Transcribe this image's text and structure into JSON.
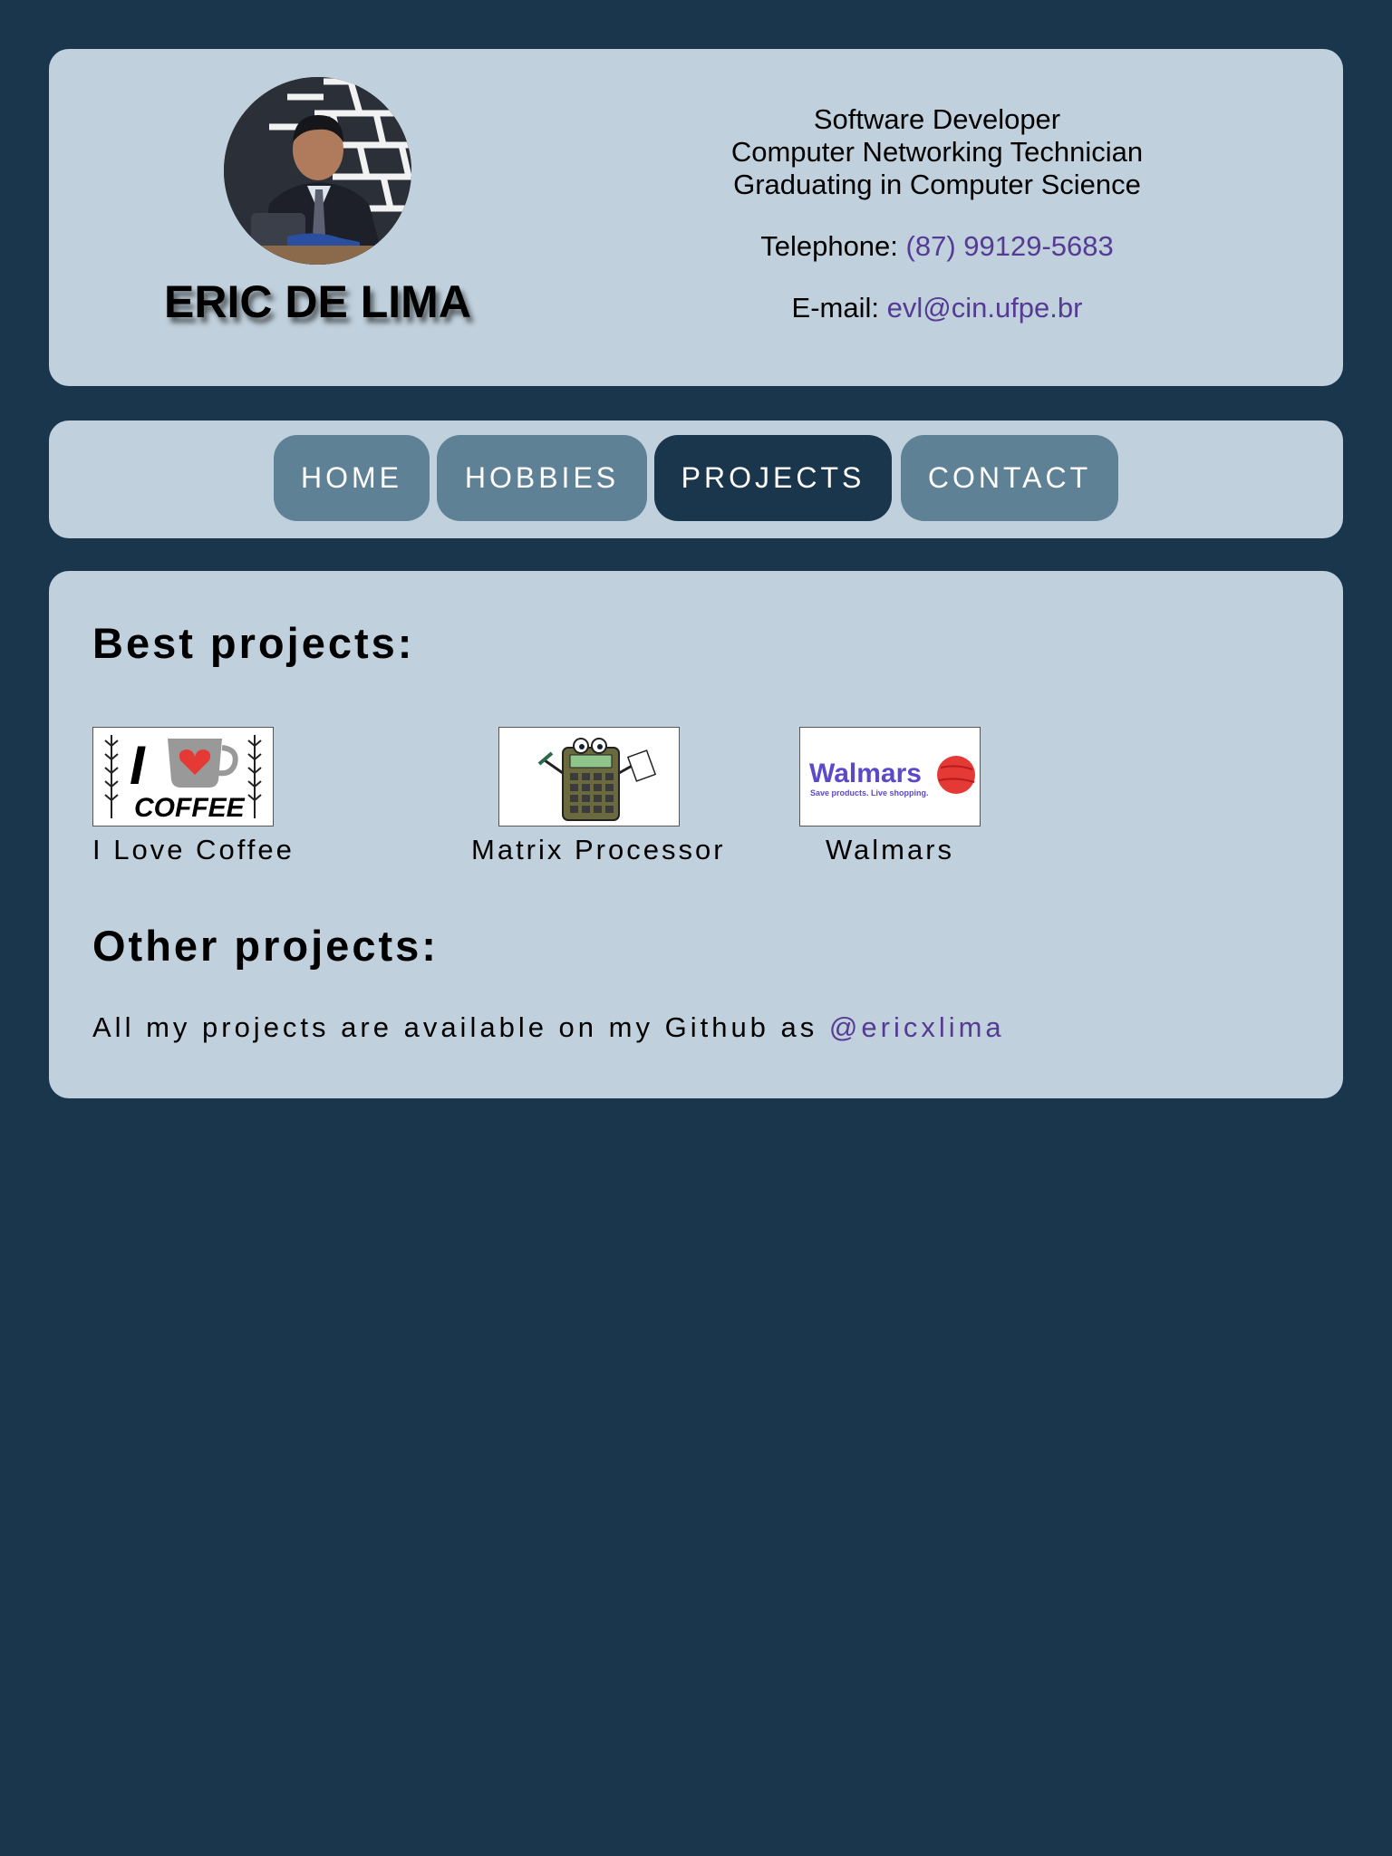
{
  "profile": {
    "name": "ERIC DE LIMA",
    "roles": [
      "Software Developer",
      "Computer Networking Technician",
      "Graduating in Computer Science"
    ],
    "telephone_label": "Telephone:",
    "telephone_value": "(87) 99129-5683",
    "email_label": "E-mail:",
    "email_value": "evl@cin.ufpe.br"
  },
  "nav": {
    "items": [
      {
        "label": "HOME"
      },
      {
        "label": "HOBBIES"
      },
      {
        "label": "PROJECTS",
        "active": true
      },
      {
        "label": "CONTACT"
      }
    ]
  },
  "projects": {
    "best_title": "Best projects:",
    "best": [
      {
        "label": "I Love Coffee",
        "thumb_icon": "coffee-logo",
        "thumb_text_top": "I",
        "thumb_text_bottom": "COFFEE"
      },
      {
        "label": "Matrix Processor",
        "thumb_icon": "calculator-mascot"
      },
      {
        "label": "Walmars",
        "thumb_icon": "walmars-logo",
        "thumb_text_top": "Walmars",
        "thumb_text_bottom": "Save products. Live shopping."
      }
    ],
    "other_title": "Other projects:",
    "other_text": "All my projects are available on my Github as",
    "github_handle": "@ericxlima"
  },
  "colors": {
    "background": "#19364d",
    "card": "#c0d0dc",
    "nav_button": "#5f8196",
    "nav_button_active": "#19364d",
    "link": "#553b94"
  }
}
